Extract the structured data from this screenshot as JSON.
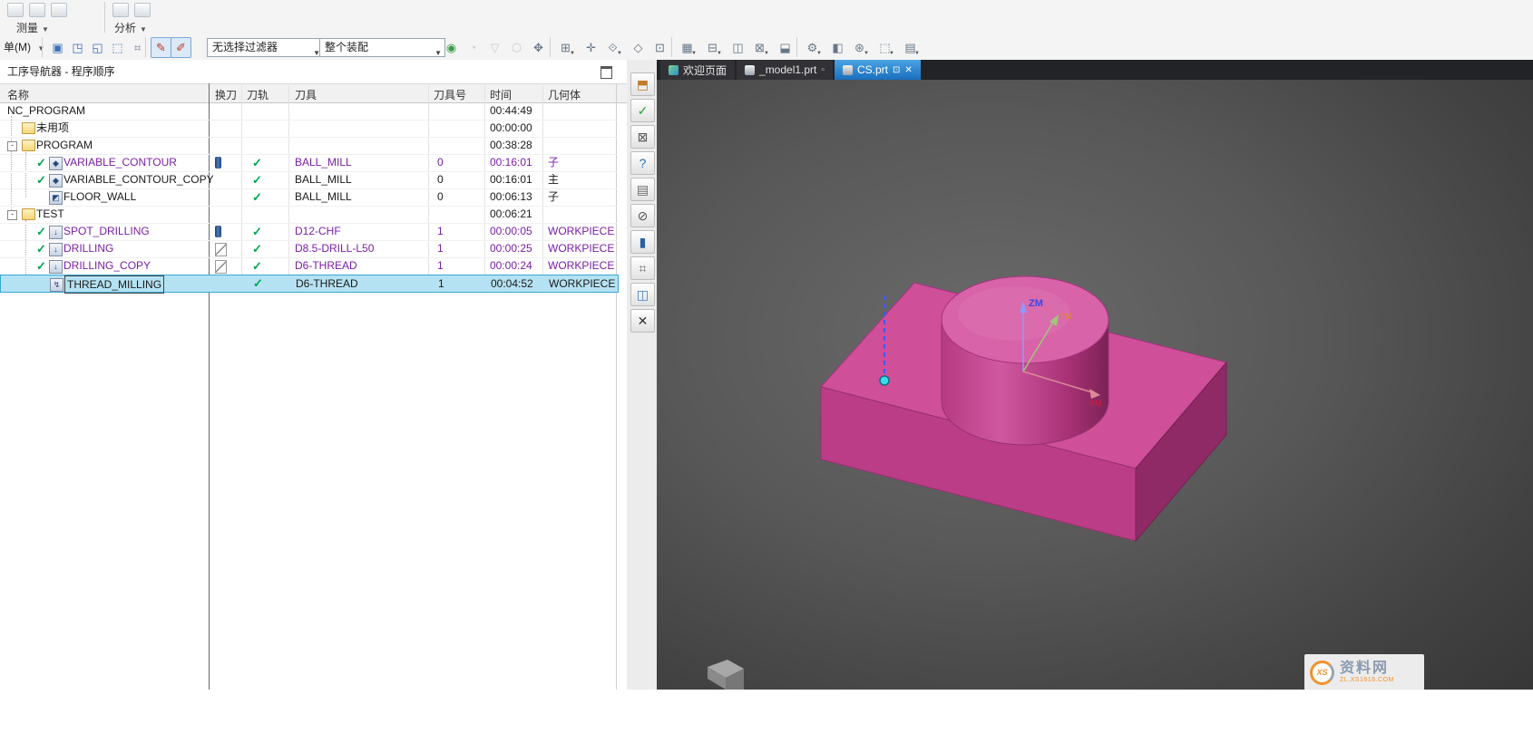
{
  "colors": {
    "purple": "#7a1fa2",
    "green_check": "#00a651",
    "selected_bg": "#b5e2f2",
    "selected_border": "#38a7d4",
    "tab_active_blue": "#2f8fd6",
    "part_pink": "#cf4f99"
  },
  "ribbon": {
    "menu_label": "单(M)",
    "menu_caret": "▼",
    "groups": [
      {
        "label": "测量",
        "caret": "▼"
      },
      {
        "label": "分析",
        "caret": "▼"
      }
    ],
    "filter_combo": "无选择过滤器",
    "assembly_combo": "整个装配"
  },
  "toolbar": {
    "icons": [
      {
        "g": "▣",
        "c": "#3f6fb5"
      },
      {
        "g": "◳",
        "c": "#3f6fb5"
      },
      {
        "g": "◱",
        "c": "#3f6fb5"
      },
      {
        "g": "⬚",
        "c": "#3f6fb5"
      },
      {
        "g": "⌗",
        "c": "#6a7f98"
      },
      {
        "g": "✎",
        "c": "#c0392b",
        "toggled": true
      },
      {
        "g": "✐",
        "c": "#c0392b",
        "toggled": true
      },
      {
        "g": "◉",
        "c": "#3f9d44"
      },
      {
        "g": "◔",
        "c": "#8a8a8a",
        "dim": true
      },
      {
        "g": "▽",
        "c": "#8a8a8a",
        "dim": true
      },
      {
        "g": "⬡",
        "c": "#8a8a8a",
        "dim": true
      },
      {
        "g": "✥",
        "c": "#667788"
      },
      {
        "g": "⊞",
        "c": "#667788",
        "caret": true
      },
      {
        "g": "✛",
        "c": "#667788"
      },
      {
        "g": "⟐",
        "c": "#667788",
        "caret": true
      },
      {
        "g": "◇",
        "c": "#667788"
      },
      {
        "g": "⊡",
        "c": "#667788"
      },
      {
        "g": "▦",
        "c": "#667788",
        "caret": true
      },
      {
        "g": "⊟",
        "c": "#667788",
        "caret": true
      },
      {
        "g": "◫",
        "c": "#667788"
      },
      {
        "g": "⊠",
        "c": "#667788",
        "caret": true
      },
      {
        "g": "⬓",
        "c": "#667788"
      },
      {
        "g": "⚙",
        "c": "#667788",
        "caret": true
      },
      {
        "g": "◧",
        "c": "#667788"
      },
      {
        "g": "⊛",
        "c": "#667788",
        "caret": true
      },
      {
        "g": "⬚",
        "c": "#667788",
        "caret": true
      },
      {
        "g": "▤",
        "c": "#667788",
        "caret": true
      }
    ]
  },
  "resource_bar": {
    "icons": [
      {
        "name": "assembly-navigator-icon",
        "g": "⬒",
        "c": "#c07a2a"
      },
      {
        "name": "constraint-navigator-icon",
        "g": "✓",
        "c": "#2e9e44"
      },
      {
        "name": "part-navigator-icon",
        "g": "⊠",
        "c": "#555555"
      },
      {
        "name": "help-icon",
        "g": "?",
        "c": "#2a6fb0"
      },
      {
        "name": "history-icon",
        "g": "▤",
        "c": "#6a6a6a"
      },
      {
        "name": "no-entry-icon",
        "g": "⊘",
        "c": "#555555"
      },
      {
        "name": "process-navigator-icon",
        "g": "▮",
        "c": "#2a5fa0"
      },
      {
        "name": "machine-navigator-icon",
        "g": "⌗",
        "c": "#6a6a6a"
      },
      {
        "name": "web-browser-icon",
        "g": "◫",
        "c": "#3a7fc0"
      },
      {
        "name": "close-navigator-icon",
        "g": "✕",
        "c": "#333333"
      }
    ]
  },
  "navigator": {
    "title": "工序导航器 - 程序顺序",
    "columns": [
      "名称",
      "换刀",
      "刀轨",
      "刀具",
      "刀具号",
      "时间",
      "几何体"
    ],
    "rows": [
      {
        "name": "NC_PROGRAM",
        "indent": 0,
        "time": "00:44:49"
      },
      {
        "name": "未用项",
        "indent": 1,
        "icon": "folder",
        "time": "00:00:00"
      },
      {
        "name": "PROGRAM",
        "indent": 1,
        "icon": "folder",
        "expander": true,
        "time": "00:38:28"
      },
      {
        "name": "VARIABLE_CONTOUR",
        "indent": 2,
        "icon": "vc",
        "check": true,
        "name_color": "purple",
        "toolchange": "blue",
        "path_ok": true,
        "tool": "BALL_MILL",
        "tool_color": "purple",
        "tool_no": "0",
        "tool_no_color": "purple",
        "time": "00:16:01",
        "time_color": "purple",
        "geom": "子",
        "geom_color": "purple"
      },
      {
        "name": "VARIABLE_CONTOUR_COPY",
        "indent": 2,
        "icon": "vc",
        "check": true,
        "path_ok": true,
        "tool": "BALL_MILL",
        "tool_no": "0",
        "time": "00:16:01",
        "geom": "主"
      },
      {
        "name": "FLOOR_WALL",
        "indent": 2,
        "icon": "mill",
        "path_ok": true,
        "tool": "BALL_MILL",
        "tool_no": "0",
        "time": "00:06:13",
        "geom": "子"
      },
      {
        "name": "TEST",
        "indent": 1,
        "icon": "folder",
        "expander": true,
        "time": "00:06:21"
      },
      {
        "name": "SPOT_DRILLING",
        "indent": 2,
        "icon": "drill",
        "check": true,
        "name_color": "purple",
        "toolchange": "blue",
        "path_ok": true,
        "tool": "D12-CHF",
        "tool_color": "purple",
        "tool_no": "1",
        "tool_no_color": "purple",
        "time": "00:00:05",
        "time_color": "purple",
        "geom": "WORKPIECE",
        "geom_color": "purple"
      },
      {
        "name": "DRILLING",
        "indent": 2,
        "icon": "drill",
        "check": true,
        "name_color": "purple",
        "toolchange": "gray",
        "path_ok": true,
        "tool": "D8.5-DRILL-L50",
        "tool_color": "purple",
        "tool_no": "1",
        "tool_no_color": "purple",
        "time": "00:00:25",
        "time_color": "purple",
        "geom": "WORKPIECE",
        "geom_color": "purple"
      },
      {
        "name": "DRILLING_COPY",
        "indent": 2,
        "icon": "drill",
        "check": true,
        "name_color": "purple",
        "toolchange": "gray",
        "path_ok": true,
        "tool": "D6-THREAD",
        "tool_color": "purple",
        "tool_no": "1",
        "tool_no_color": "purple",
        "time": "00:00:24",
        "time_color": "purple",
        "geom": "WORKPIECE",
        "geom_color": "purple"
      },
      {
        "name": "THREAD_MILLING",
        "indent": 2,
        "icon": "tap",
        "path_ok": true,
        "tool": "D6-THREAD",
        "tool_no": "1",
        "time": "00:04:52",
        "geom": "WORKPIECE",
        "selected": true
      }
    ]
  },
  "tabs": [
    {
      "label": "欢迎页面",
      "icon": "welcome"
    },
    {
      "label": "_model1.prt",
      "icon": "part",
      "aux": "▫"
    },
    {
      "label": "CS.prt",
      "icon": "part",
      "active": true,
      "restore": "⊡",
      "close": "✕"
    }
  ],
  "viewport": {
    "axes": {
      "z": "ZM",
      "y": "YM",
      "x": "XM"
    }
  },
  "watermark": {
    "logo": "XS",
    "title": "资料网",
    "subtitle": "ZL.XS1616.COM"
  }
}
